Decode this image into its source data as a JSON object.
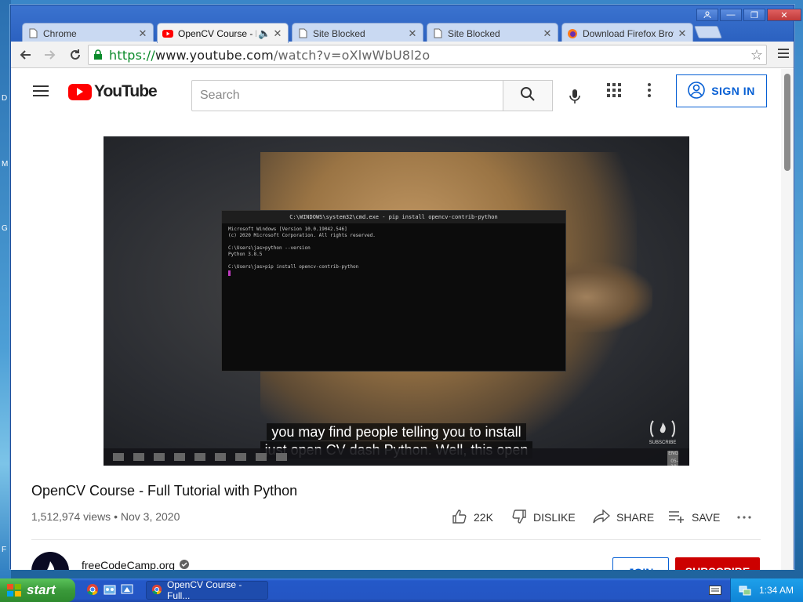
{
  "desktop": {
    "left_letters": [
      "D",
      "M",
      "G",
      "F"
    ]
  },
  "browser": {
    "tabs": [
      {
        "title": "Chrome",
        "icon": "page-icon",
        "active": false
      },
      {
        "title": "OpenCV Course - Ful",
        "icon": "youtube-icon",
        "active": true,
        "audio": true
      },
      {
        "title": "Site Blocked",
        "icon": "page-icon",
        "active": false
      },
      {
        "title": "Site Blocked",
        "icon": "page-icon",
        "active": false
      },
      {
        "title": "Download Firefox Brows",
        "icon": "firefox-icon",
        "active": false
      }
    ],
    "url": {
      "scheme": "https://",
      "host": "www.youtube.com",
      "path": "/watch?v=oXlwWbU8l2o"
    }
  },
  "youtube": {
    "logo_text": "YouTube",
    "search_placeholder": "Search",
    "sign_in_label": "SIGN IN",
    "video": {
      "cmd_title": "C:\\WINDOWS\\system32\\cmd.exe - pip install opencv-contrib-python",
      "cmd_lines": "Microsoft Windows [Version 10.0.19042.546]\n(c) 2020 Microsoft Corporation. All rights reserved.\n\nC:\\Users\\jas>python --version\nPython 3.8.5\n\nC:\\Users\\jas>pip install opencv-contrib-python",
      "caption_line1": "you may find people telling you to install",
      "caption_line2": "just open CV dash Python. Well, this open",
      "w10_lang": "ENG",
      "w10_date": "05-10-2020",
      "subscribe_mark": "SUBSCRIBE"
    },
    "title": "OpenCV Course - Full Tutorial with Python",
    "views": "1,512,974 views",
    "date": "Nov 3, 2020",
    "actions": {
      "like_count": "22K",
      "dislike_label": "DISLIKE",
      "share_label": "SHARE",
      "save_label": "SAVE"
    },
    "channel": {
      "name": "freeCodeCamp.org",
      "join_label": "JOIN",
      "subscribe_label": "SUBSCRIBE"
    }
  },
  "taskbar": {
    "start_label": "start",
    "task_item": "OpenCV Course - Full...",
    "clock": "1:34 AM"
  }
}
